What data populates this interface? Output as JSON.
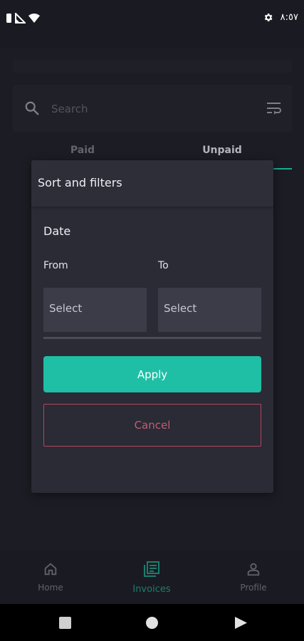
{
  "status_bar": {
    "time": "٨:٥٧",
    "icons": [
      "battery-icon",
      "signal-icon",
      "wifi-icon",
      "settings-icon"
    ]
  },
  "search": {
    "placeholder": "Search"
  },
  "tabs": [
    {
      "label": "Paid",
      "active": false
    },
    {
      "label": "Unpaid",
      "active": true
    }
  ],
  "dialog": {
    "title": "Sort and filters",
    "section": "Date",
    "from_label": "From",
    "to_label": "To",
    "from_value": "Select",
    "to_value": "Select",
    "apply_label": "Apply",
    "cancel_label": "Cancel"
  },
  "bottom_nav": [
    {
      "label": "Home",
      "icon": "home-icon",
      "active": false
    },
    {
      "label": "Invoices",
      "icon": "invoices-icon",
      "active": true
    },
    {
      "label": "Profile",
      "icon": "profile-icon",
      "active": false
    }
  ],
  "android_nav": [
    "recents-button",
    "home-button",
    "back-button"
  ],
  "colors": {
    "accent": "#1fbfa6",
    "danger": "#b3475e",
    "background": "#202129",
    "dialog": "#2a2b35"
  }
}
